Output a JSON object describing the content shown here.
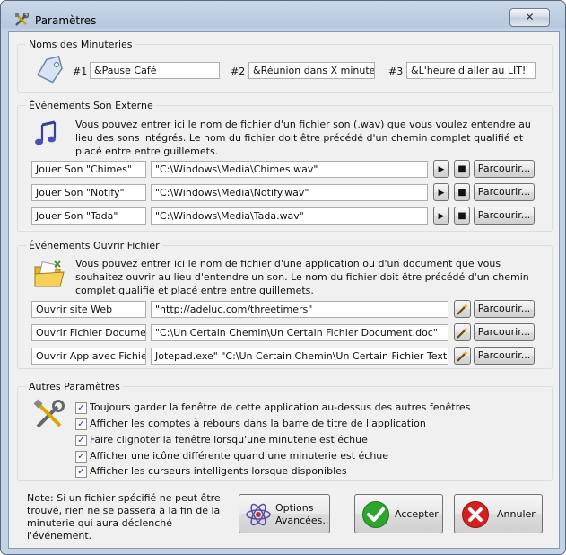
{
  "window": {
    "title": "Paramètres",
    "close_glyph": "✕"
  },
  "timer_names": {
    "legend": "Noms des Minuteries",
    "items": [
      {
        "number": "#1",
        "value": "&Pause Café"
      },
      {
        "number": "#2",
        "value": "&Réunion dans X minutes"
      },
      {
        "number": "#3",
        "value": "&L'heure d'aller au LIT!"
      }
    ]
  },
  "sound_events": {
    "legend": "Événements Son Externe",
    "description": "Vous pouvez entrer ici le nom de fichier d'un fichier son (.wav) que vous voulez entendre au lieu des sons intégrés.  Le nom du fichier doit être précédé d'un chemin complet qualifié et placé entre entre guillemets.",
    "rows": [
      {
        "label": "Jouer Son \"Chimes\"",
        "path": "\"C:\\Windows\\Media\\Chimes.wav\""
      },
      {
        "label": "Jouer Son \"Notify\"",
        "path": "\"C:\\Windows\\Media\\Notify.wav\""
      },
      {
        "label": "Jouer Son \"Tada\"",
        "path": "\"C:\\Windows\\Media\\Tada.wav\""
      }
    ],
    "play_glyph": "▶",
    "stop_glyph": "■",
    "browse_label": "Parcourir..."
  },
  "file_events": {
    "legend": "Événements Ouvrir Fichier",
    "description": "Vous pouvez entrer ici le nom de fichier d'une application ou d'un document que vous souhaitez ouvrir au lieu d'entendre un son.  Le nom du fichier doit être précédé d'un chemin complet qualifié et placé entre entre guillemets.",
    "rows": [
      {
        "label": "Ouvrir site Web",
        "path": "\"http://adeluc.com/threetimers\""
      },
      {
        "label": "Ouvrir Fichier Documen",
        "path": "\"C:\\Un Certain Chemin\\Un Certain Fichier Document.doc\""
      },
      {
        "label": "Ouvrir App avec Fichier",
        "path": "Jotepad.exe\" \"C:\\Un Certain Chemin\\Un Certain Fichier Text.txt\""
      }
    ],
    "browse_label": "Parcourir..."
  },
  "other_settings": {
    "legend": "Autres Paramètres",
    "checkmark": "✓",
    "options": [
      {
        "label": "Toujours garder la fenêtre de cette application au-dessus des autres fenêtres",
        "checked": true
      },
      {
        "label": "Afficher les comptes à rebours dans la barre de titre de l'application",
        "checked": true
      },
      {
        "label": "Faire clignoter la fenêtre lorsqu'une minuterie est échue",
        "checked": true
      },
      {
        "label": "Afficher une icône différente quand une minuterie est échue",
        "checked": true
      },
      {
        "label": "Afficher les curseurs intelligents lorsque disponibles",
        "checked": true
      }
    ]
  },
  "footer": {
    "note": "Note: Si un fichier spécifié ne peut être trouvé, rien ne se passera à la fin de la minuterie qui aura déclenché l'événement.",
    "advanced_line1": "Options",
    "advanced_line2": "Avancées...",
    "accept_label": "Accepter",
    "cancel_label": "Annuler"
  },
  "colors": {
    "accept_green": "#2fa52f",
    "cancel_red": "#d62020",
    "title_gradient": "#b6c8df"
  }
}
